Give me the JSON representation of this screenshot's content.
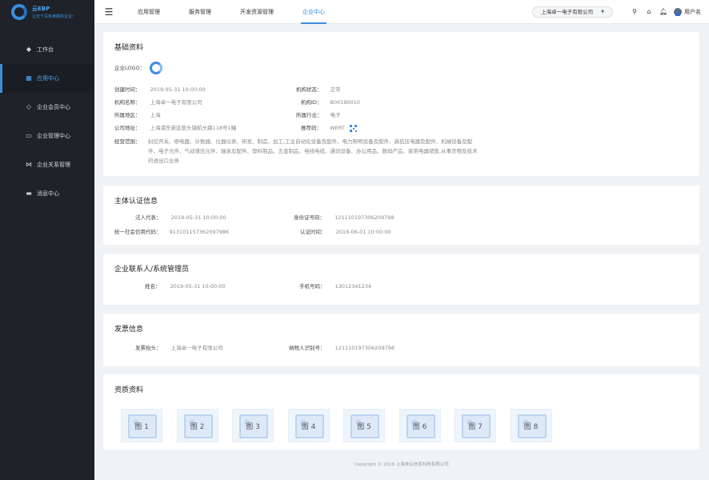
{
  "brand": {
    "title": "云EBP",
    "slogan": "让天下没有难做的企业!"
  },
  "sidebar": {
    "items": [
      {
        "label": "工作台",
        "icon": "layers-icon"
      },
      {
        "label": "应用中心",
        "icon": "grid-icon",
        "active": true
      },
      {
        "label": "企业会员中心",
        "icon": "diamond-icon"
      },
      {
        "label": "企业管理中心",
        "icon": "monitor-icon"
      },
      {
        "label": "企业关系管理",
        "icon": "share-icon"
      },
      {
        "label": "消息中心",
        "icon": "message-icon"
      }
    ]
  },
  "header": {
    "tabs": [
      {
        "label": "应用管理"
      },
      {
        "label": "服务管理"
      },
      {
        "label": "开发资源管理"
      },
      {
        "label": "企业中心",
        "active": true
      }
    ],
    "company": "上海卓一电子有限公司",
    "username": "用户名"
  },
  "basic": {
    "title": "基础资料",
    "logo_label": "企业LOGO：",
    "created_label": "创建时间：",
    "created": "2019-05-31 10:00:00",
    "status_label": "机构状态：",
    "status": "正常",
    "name_label": "机构名称：",
    "name": "上海卓一电子有限公司",
    "org_id_label": "机构ID：",
    "org_id": "B00190010",
    "region_label": "所属地区：",
    "region": "上海",
    "industry_label": "所属行业：",
    "industry": "电子",
    "address_label": "公司地址：",
    "address": "上海浦东新区航头镇航头路118号1幢",
    "referral_label": "推荐码：",
    "referral": "WERT",
    "scope_label": "经营范围：",
    "scope_line1": "封控开关、继电器、计数器、仪器仪表、研发、制造、加工,工业自动化设备及配件、电力照明设备及配件、高低压电器及配件、机械设备及配",
    "scope_line2": "件、电子元件、气动液压元件、轴承及配件、塑料制品、五金制品、电线电缆、通讯设备、办公用品、数码产品、家用电器销售,从事货物及技术",
    "scope_line3": "的进出口业务"
  },
  "cert": {
    "title": "主体认证信息",
    "legal_label": "法人代表：",
    "legal": "2019-05-31 10:00:00",
    "idno_label": "身份证号码：",
    "idno": "121110197306209798",
    "credit_label": "统一社会信用代码：",
    "credit": "91310115736209798K",
    "certtime_label": "认证时间：",
    "certtime": "2019-06-01 10:00:00"
  },
  "contact": {
    "title": "企业联系人/系统管理员",
    "name_label": "姓名：",
    "name": "2019-05-31 10:00:00",
    "phone_label": "手机号码：",
    "phone": "13012341234"
  },
  "invoice": {
    "title": "发票信息",
    "head_label": "发票抬头：",
    "head": "上海卓一电子有限公司",
    "taxno_label": "纳税人识别号：",
    "taxno": "121110197306209798"
  },
  "qualification": {
    "title": "资质资料",
    "images": [
      "图 1",
      "图 2",
      "图 3",
      "图 4",
      "图 5",
      "图 6",
      "图 7",
      "图 8"
    ]
  },
  "footer": {
    "copyright": "Copyright © 2019 上海奔云信息科技有限公司"
  }
}
